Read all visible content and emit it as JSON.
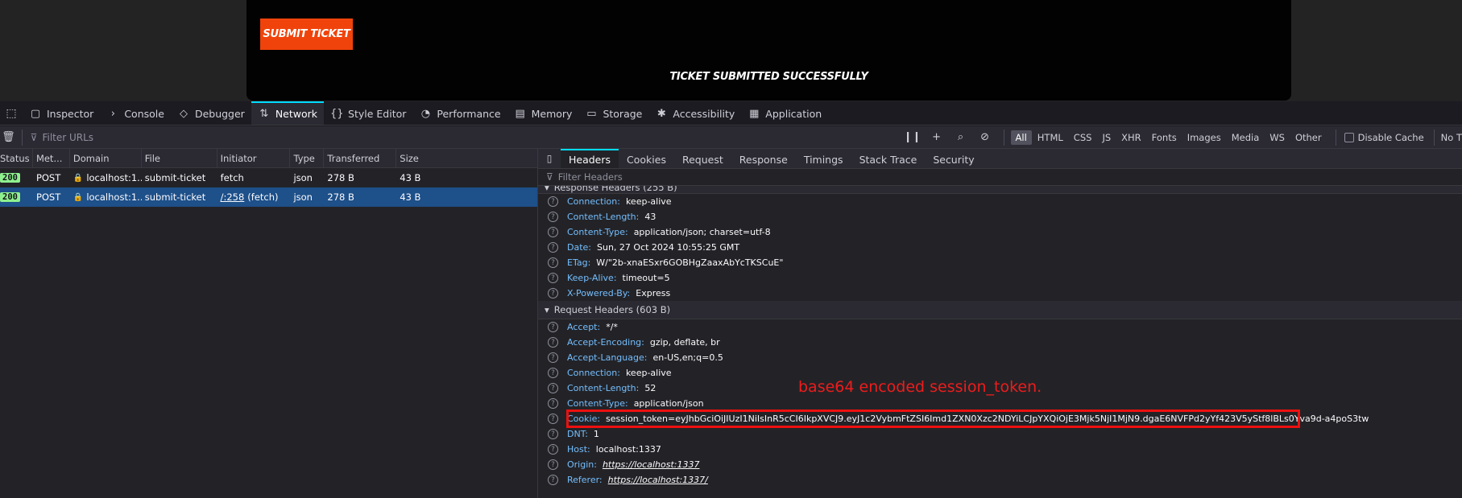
{
  "page": {
    "submit_button": "Submit Ticket",
    "success_message": "Ticket Submitted Successfully"
  },
  "devtools_tabs": [
    {
      "label": "Inspector",
      "icon": "inspector-icon",
      "glyph": "▢"
    },
    {
      "label": "Console",
      "icon": "console-icon",
      "glyph": "›"
    },
    {
      "label": "Debugger",
      "icon": "debugger-icon",
      "glyph": "◇"
    },
    {
      "label": "Network",
      "icon": "network-icon",
      "glyph": "⇅"
    },
    {
      "label": "Style Editor",
      "icon": "style-editor-icon",
      "glyph": "{}"
    },
    {
      "label": "Performance",
      "icon": "performance-icon",
      "glyph": "◔"
    },
    {
      "label": "Memory",
      "icon": "memory-icon",
      "glyph": "▤"
    },
    {
      "label": "Storage",
      "icon": "storage-icon",
      "glyph": "▭"
    },
    {
      "label": "Accessibility",
      "icon": "accessibility-icon",
      "glyph": "✱"
    },
    {
      "label": "Application",
      "icon": "application-icon",
      "glyph": "▦"
    }
  ],
  "toolbar": {
    "filter_placeholder": "Filter URLs",
    "type_filters": [
      "All",
      "HTML",
      "CSS",
      "JS",
      "XHR",
      "Fonts",
      "Images",
      "Media",
      "WS",
      "Other"
    ],
    "disable_cache": "Disable Cache",
    "throttle": "No T"
  },
  "request_columns": [
    "Status",
    "Met...",
    "Domain",
    "File",
    "Initiator",
    "Type",
    "Transferred",
    "Size"
  ],
  "requests": [
    {
      "status": "200",
      "method": "POST",
      "domain": "localhost:1...",
      "file": "submit-ticket",
      "initiator": "fetch",
      "initiator_link": "",
      "type": "json",
      "transferred": "278 B",
      "size": "43 B"
    },
    {
      "status": "200",
      "method": "POST",
      "domain": "localhost:1...",
      "file": "submit-ticket",
      "initiator": " (fetch)",
      "initiator_link": "/:258",
      "type": "json",
      "transferred": "278 B",
      "size": "43 B"
    }
  ],
  "details": {
    "tabs": [
      "Headers",
      "Cookies",
      "Request",
      "Response",
      "Timings",
      "Stack Trace",
      "Security"
    ],
    "filter_placeholder": "Filter Headers",
    "response_section": "Response Headers (255 B)",
    "response_headers": [
      {
        "name": "Connection:",
        "value": "keep-alive"
      },
      {
        "name": "Content-Length:",
        "value": "43"
      },
      {
        "name": "Content-Type:",
        "value": "application/json; charset=utf-8"
      },
      {
        "name": "Date:",
        "value": "Sun, 27 Oct 2024 10:55:25 GMT"
      },
      {
        "name": "ETag:",
        "value": "W/\"2b-xnaESxr6GOBHgZaaxAbYcTKSCuE\""
      },
      {
        "name": "Keep-Alive:",
        "value": "timeout=5"
      },
      {
        "name": "X-Powered-By:",
        "value": "Express"
      }
    ],
    "request_section": "Request Headers (603 B)",
    "request_headers": [
      {
        "name": "Accept:",
        "value": "*/*"
      },
      {
        "name": "Accept-Encoding:",
        "value": "gzip, deflate, br"
      },
      {
        "name": "Accept-Language:",
        "value": "en-US,en;q=0.5"
      },
      {
        "name": "Connection:",
        "value": "keep-alive"
      },
      {
        "name": "Content-Length:",
        "value": "52"
      },
      {
        "name": "Content-Type:",
        "value": "application/json"
      },
      {
        "name": "Cookie:",
        "value": "session_token=eyJhbGciOiJIUzI1NiIsInR5cCI6IkpXVCJ9.eyJ1c2VybmFtZSI6Imd1ZXN0Xzc2NDYiLCJpYXQiOjE3Mjk5NjI1MjN9.dgaE6NVFPd2yYf423V5yStf8lBLs0Yva9d-a4poS3tw"
      },
      {
        "name": "DNT:",
        "value": "1"
      },
      {
        "name": "Host:",
        "value": "localhost:1337"
      },
      {
        "name": "Origin:",
        "value": "https://localhost:1337"
      },
      {
        "name": "Referer:",
        "value": "https://localhost:1337/"
      }
    ]
  },
  "annotation": "base64 encoded session_token.",
  "colors": {
    "accent": "#00ddff",
    "submit_bg": "#f0430b",
    "highlight": "#ee0f0f",
    "selected_row": "#1e5089"
  }
}
